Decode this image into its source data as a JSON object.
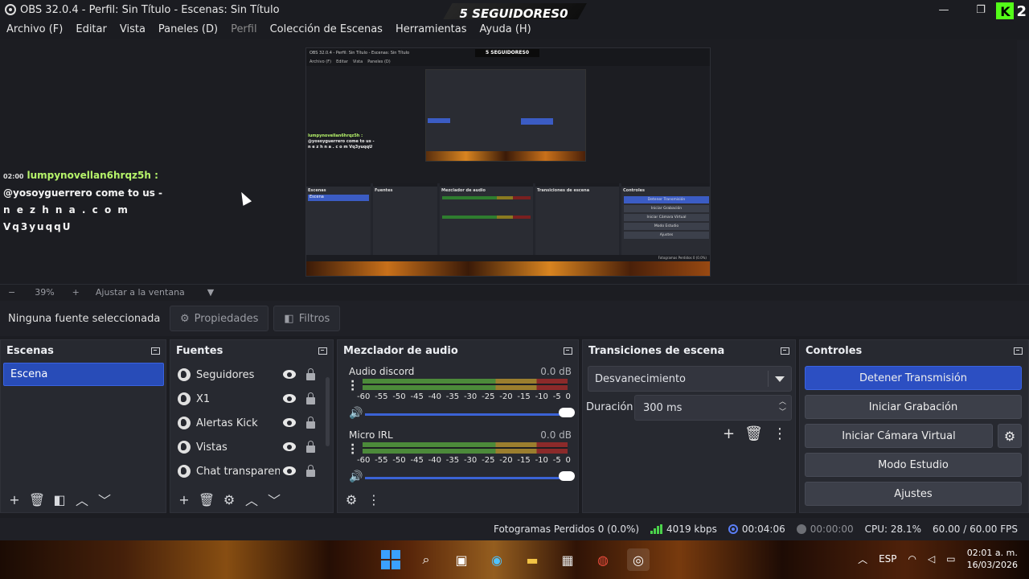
{
  "window": {
    "title": "OBS 32.0.4 - Perfil: Sin Título - Escenas: Sin Título",
    "banner": "5 SEGUIDORES0",
    "kick_count": "2",
    "kick_letter": "K"
  },
  "menu": {
    "archivo": "Archivo (F)",
    "editar": "Editar",
    "vista": "Vista",
    "paneles": "Paneles (D)",
    "perfil": "Perfil",
    "coleccion": "Colección de Escenas",
    "herramientas": "Herramientas",
    "ayuda": "Ayuda (H)"
  },
  "preview": {
    "chat": {
      "time": "02:00",
      "user": "lumpynovellan6hrqz5h :",
      "line2": "@yosoyguerrero come to us -",
      "line3": "n e z h n a . c o m  Vq3yuqqU"
    },
    "nested": {
      "title": "OBS 32.0.4 - Perfil: Sin Título - Escenas: Sin Título",
      "banner": "5 SEGUIDORES0",
      "chat_user": "lumpynovellan6hrqz5h :",
      "chat_line2": "@yosoyguerrero come to us -",
      "chat_line3": "n e z h n a . c o m Vq3yuqqU"
    }
  },
  "zoom": {
    "minus": "−",
    "value": "39%",
    "plus": "+",
    "fit": "Ajustar a la ventana"
  },
  "source_toolbar": {
    "no_selection": "Ninguna fuente seleccionada",
    "properties": "Propiedades",
    "filters": "Filtros"
  },
  "scenes": {
    "title": "Escenas",
    "items": [
      "Escena"
    ]
  },
  "sources": {
    "title": "Fuentes",
    "items": [
      "Seguidores",
      "X1",
      "Alertas Kick",
      "Vistas",
      "Chat transparente"
    ]
  },
  "mixer": {
    "title": "Mezclador de audio",
    "channels": [
      {
        "name": "Audio discord",
        "db": "0.0 dB",
        "volume": 1.0
      },
      {
        "name": "Micro IRL",
        "db": "0.0 dB",
        "volume": 1.0
      }
    ],
    "ticks": [
      "-60",
      "-55",
      "-50",
      "-45",
      "-40",
      "-35",
      "-30",
      "-25",
      "-20",
      "-15",
      "-10",
      "-5",
      "0"
    ]
  },
  "transitions": {
    "title": "Transiciones de escena",
    "selected": "Desvanecimiento",
    "duration_label": "Duración",
    "duration_value": "300 ms"
  },
  "controls": {
    "title": "Controles",
    "stop_stream": "Detener Transmisión",
    "start_recording": "Iniciar Grabación",
    "start_virtual_cam": "Iniciar Cámara Virtual",
    "studio_mode": "Modo Estudio",
    "settings": "Ajustes"
  },
  "status": {
    "dropped_frames": "Fotogramas Perdidos 0 (0.0%)",
    "bitrate": "4019 kbps",
    "stream_time": "00:04:06",
    "rec_time": "00:00:00",
    "cpu": "CPU: 28.1%",
    "fps": "60.00 / 60.00 FPS"
  },
  "taskbar": {
    "lang": "ESP",
    "time": "02:01 a. m.",
    "date": "16/03/2026"
  },
  "colors": {
    "accent": "#284cb8",
    "kick_green": "#53fc18",
    "dock_bg": "#272930"
  }
}
